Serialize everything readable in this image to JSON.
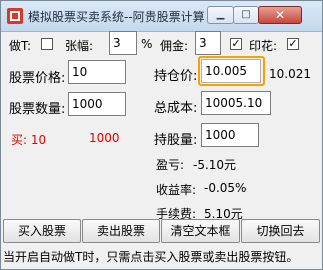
{
  "window": {
    "title": "模拟股票买卖系统--阿贵股票计算...",
    "minimize_glyph": "▁",
    "maximize_glyph": "□",
    "close_glyph": "✕"
  },
  "options": {
    "t0_label": "做T:",
    "t0_checked": false,
    "price_limit_label": "张幅:",
    "price_limit_value": "3",
    "percent_sign": "%",
    "commission_label": "佣金:",
    "commission_value": "3",
    "commission_checked": true,
    "stamp_tax_label": "印花:",
    "stamp_tax_checked": true
  },
  "form": {
    "stock_price_label": "股票价格:",
    "stock_price_value": "10",
    "holding_price_label": "持仓价:",
    "holding_price_value": "10.005",
    "holding_price_note": "10.021",
    "stock_qty_label": "股票数量:",
    "stock_qty_value": "1000",
    "total_cost_label": "总成本:",
    "total_cost_value": "10005.10",
    "buy_label": "买: 10",
    "buy_qty": "1000",
    "holding_qty_label": "持股量:",
    "holding_qty_value": "1000",
    "profit_label": "盈亏:",
    "profit_value": "-5.10元",
    "yield_label": "收益率:",
    "yield_value": "-0.05%",
    "fee_label": "手续费:",
    "fee_value": "5.10元"
  },
  "buttons": {
    "buy": "买入股票",
    "sell": "卖出股票",
    "clear": "清空文本框",
    "switch_back": "切换回去"
  },
  "status": "当开启自动做T时，只需点击买入股票或卖出股票按钮。",
  "colors": {
    "accent_focus": "#f5a300",
    "highlight_red": "#e00000"
  }
}
